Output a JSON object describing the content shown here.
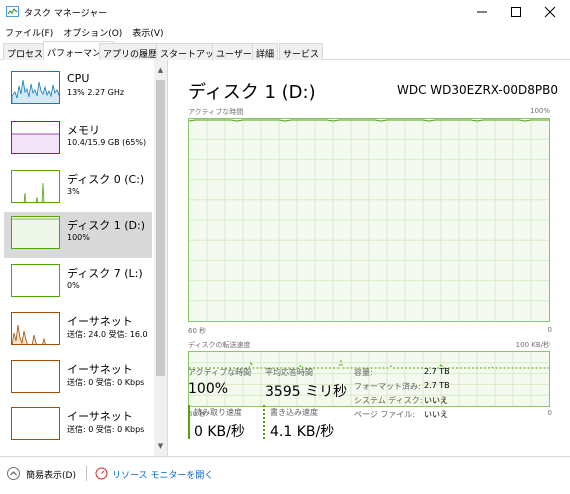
{
  "window": {
    "title": "タスク マネージャー"
  },
  "menu": [
    "ファイル(F)",
    "オプション(O)",
    "表示(V)"
  ],
  "tabs": [
    {
      "label": "プロセス",
      "active": false
    },
    {
      "label": "パフォーマンス",
      "active": true
    },
    {
      "label": "アプリの履歴",
      "active": false
    },
    {
      "label": "スタートアップ",
      "active": false
    },
    {
      "label": "ユーザー",
      "active": false
    },
    {
      "label": "詳細",
      "active": false
    },
    {
      "label": "サービス",
      "active": false
    }
  ],
  "sidebar": [
    {
      "name": "CPU",
      "sub": "13%  2.27 GHz",
      "color": "#117dbb",
      "selected": false
    },
    {
      "name": "メモリ",
      "sub": "10.4/15.9 GB (65%)",
      "color": "#8b12ae",
      "selected": false
    },
    {
      "name": "ディスク 0 (C:)",
      "sub": "3%",
      "color": "#4da60c",
      "selected": false
    },
    {
      "name": "ディスク 1 (D:)",
      "sub": "100%",
      "color": "#4da60c",
      "selected": true
    },
    {
      "name": "ディスク 7 (L:)",
      "sub": "0%",
      "color": "#4da60c",
      "selected": false
    },
    {
      "name": "イーサネット",
      "sub": "送信: 24.0  受信: 16.0",
      "color": "#a74f01",
      "selected": false
    },
    {
      "name": "イーサネット",
      "sub": "送信: 0  受信: 0 Kbps",
      "color": "#a74f01",
      "selected": false
    },
    {
      "name": "イーサネット",
      "sub": "送信: 0  受信: 0 Kbps",
      "color": "#a74f01",
      "selected": false
    }
  ],
  "main": {
    "heading": "ディスク 1 (D:)",
    "model": "WDC WD30EZRX-00D8PB0",
    "active_graph": {
      "label": "アクティブな時間",
      "max": "100%",
      "time": "60 秒",
      "zero": "0"
    },
    "transfer_graph": {
      "label": "ディスクの転送速度",
      "max": "100 KB/秒",
      "time": "60 秒",
      "zero": "0"
    },
    "stats": {
      "active_time_label": "アクティブな時間",
      "active_time": "100%",
      "avg_response_label": "平均応答時間",
      "avg_response": "3595 ミリ秒",
      "read_label": "読み取り速度",
      "read": "0 KB/秒",
      "write_label": "書き込み速度",
      "write": "4.1 KB/秒"
    },
    "props": [
      {
        "key": "容量:",
        "value": "2.7 TB"
      },
      {
        "key": "フォーマット済み:",
        "value": "2.7 TB"
      },
      {
        "key": "システム ディスク:",
        "value": "いいえ"
      },
      {
        "key": "ページ ファイル:",
        "value": "いいえ"
      }
    ]
  },
  "footer": {
    "fewer_details": "簡易表示(D)",
    "resource_monitor": "リソース モニターを開く"
  },
  "colors": {
    "disk_green": "#4da60c",
    "graph_border": "#8cc66b",
    "graph_fill": "#f4faf0",
    "grid": "#d6ebc8"
  }
}
